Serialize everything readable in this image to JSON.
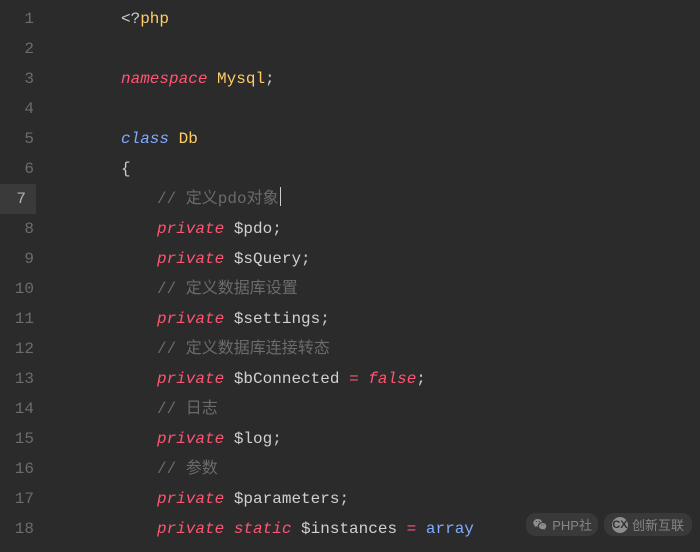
{
  "lines": [
    {
      "num": 1,
      "active": false,
      "indent": 0,
      "tokens": [
        {
          "cls": "t-punct",
          "text": "<?"
        },
        {
          "cls": "t-ident",
          "text": "php"
        }
      ]
    },
    {
      "num": 2,
      "active": false,
      "indent": 0,
      "tokens": []
    },
    {
      "num": 3,
      "active": false,
      "indent": 0,
      "tokens": [
        {
          "cls": "t-keyword",
          "text": "namespace"
        },
        {
          "cls": "t-var",
          "text": " "
        },
        {
          "cls": "t-ident",
          "text": "Mysql"
        },
        {
          "cls": "t-punct",
          "text": ";"
        }
      ]
    },
    {
      "num": 4,
      "active": false,
      "indent": 0,
      "tokens": []
    },
    {
      "num": 5,
      "active": false,
      "indent": 0,
      "tokens": [
        {
          "cls": "t-class",
          "text": "class"
        },
        {
          "cls": "t-var",
          "text": " "
        },
        {
          "cls": "t-ident",
          "text": "Db"
        }
      ]
    },
    {
      "num": 6,
      "active": false,
      "indent": 0,
      "tokens": [
        {
          "cls": "t-punct",
          "text": "{"
        }
      ]
    },
    {
      "num": 7,
      "active": true,
      "indent": 1,
      "cursor": true,
      "tokens": [
        {
          "cls": "t-comment",
          "text": "// 定义pdo对象"
        }
      ]
    },
    {
      "num": 8,
      "active": false,
      "indent": 1,
      "tokens": [
        {
          "cls": "t-keyword",
          "text": "private"
        },
        {
          "cls": "t-var",
          "text": " "
        },
        {
          "cls": "t-var",
          "text": "$pdo"
        },
        {
          "cls": "t-punct",
          "text": ";"
        }
      ]
    },
    {
      "num": 9,
      "active": false,
      "indent": 1,
      "tokens": [
        {
          "cls": "t-keyword",
          "text": "private"
        },
        {
          "cls": "t-var",
          "text": " "
        },
        {
          "cls": "t-var",
          "text": "$sQuery"
        },
        {
          "cls": "t-punct",
          "text": ";"
        }
      ]
    },
    {
      "num": 10,
      "active": false,
      "indent": 1,
      "tokens": [
        {
          "cls": "t-comment",
          "text": "// 定义数据库设置"
        }
      ]
    },
    {
      "num": 11,
      "active": false,
      "indent": 1,
      "tokens": [
        {
          "cls": "t-keyword",
          "text": "private"
        },
        {
          "cls": "t-var",
          "text": " "
        },
        {
          "cls": "t-var",
          "text": "$settings"
        },
        {
          "cls": "t-punct",
          "text": ";"
        }
      ]
    },
    {
      "num": 12,
      "active": false,
      "indent": 1,
      "tokens": [
        {
          "cls": "t-comment",
          "text": "// 定义数据库连接转态"
        }
      ]
    },
    {
      "num": 13,
      "active": false,
      "indent": 1,
      "tokens": [
        {
          "cls": "t-keyword",
          "text": "private"
        },
        {
          "cls": "t-var",
          "text": " "
        },
        {
          "cls": "t-var",
          "text": "$bConnected"
        },
        {
          "cls": "t-var",
          "text": " "
        },
        {
          "cls": "t-op",
          "text": "="
        },
        {
          "cls": "t-var",
          "text": " "
        },
        {
          "cls": "t-bool",
          "text": "false"
        },
        {
          "cls": "t-punct",
          "text": ";"
        }
      ]
    },
    {
      "num": 14,
      "active": false,
      "indent": 1,
      "tokens": [
        {
          "cls": "t-comment",
          "text": "// 日志"
        }
      ]
    },
    {
      "num": 15,
      "active": false,
      "indent": 1,
      "tokens": [
        {
          "cls": "t-keyword",
          "text": "private"
        },
        {
          "cls": "t-var",
          "text": " "
        },
        {
          "cls": "t-var",
          "text": "$log"
        },
        {
          "cls": "t-punct",
          "text": ";"
        }
      ]
    },
    {
      "num": 16,
      "active": false,
      "indent": 1,
      "tokens": [
        {
          "cls": "t-comment",
          "text": "// 参数"
        }
      ]
    },
    {
      "num": 17,
      "active": false,
      "indent": 1,
      "tokens": [
        {
          "cls": "t-keyword",
          "text": "private"
        },
        {
          "cls": "t-var",
          "text": " "
        },
        {
          "cls": "t-var",
          "text": "$parameters"
        },
        {
          "cls": "t-punct",
          "text": ";"
        }
      ]
    },
    {
      "num": 18,
      "active": false,
      "indent": 1,
      "tokens": [
        {
          "cls": "t-keyword",
          "text": "private"
        },
        {
          "cls": "t-var",
          "text": " "
        },
        {
          "cls": "t-static",
          "text": "static"
        },
        {
          "cls": "t-var",
          "text": " "
        },
        {
          "cls": "t-var",
          "text": "$instances"
        },
        {
          "cls": "t-var",
          "text": " "
        },
        {
          "cls": "t-op",
          "text": "="
        },
        {
          "cls": "t-var",
          "text": " "
        },
        {
          "cls": "t-func",
          "text": "array"
        }
      ]
    }
  ],
  "watermark": {
    "left_text": "PHP社",
    "right_text": "创新互联",
    "right_badge": "CX"
  }
}
